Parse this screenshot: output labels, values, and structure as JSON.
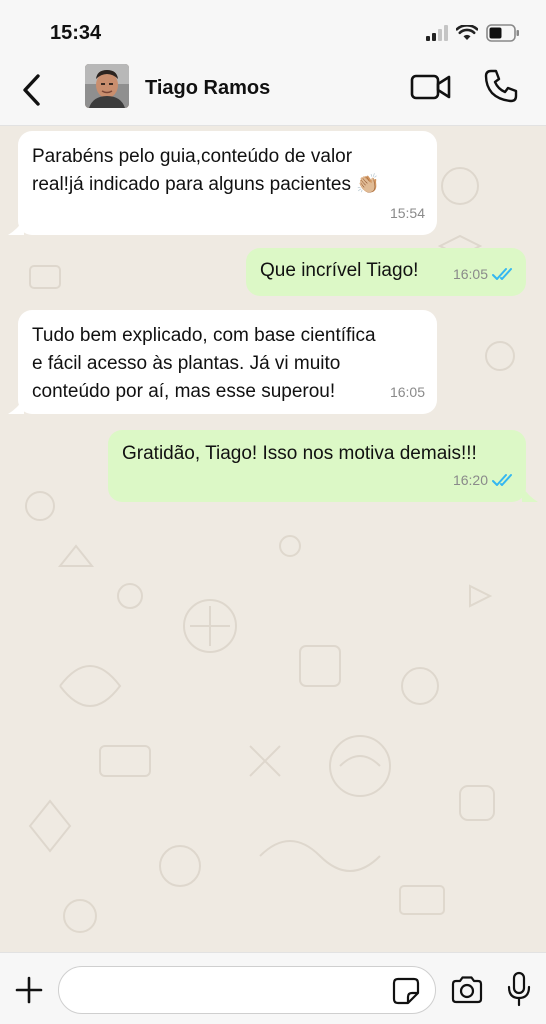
{
  "status": {
    "time": "15:34"
  },
  "contact": {
    "name": "Tiago Ramos"
  },
  "messages": [
    {
      "direction": "incoming",
      "lines": [
        "Parabéns pelo guia,conteúdo de valor",
        "real!já indicado para alguns pacientes 👏🏼"
      ],
      "time": "15:54"
    },
    {
      "direction": "outgoing",
      "text": "Que incrível Tiago!",
      "time": "16:05",
      "status": "read"
    },
    {
      "direction": "incoming",
      "lines": [
        "Tudo bem explicado, com base científica",
        "e fácil acesso às plantas. Já vi muito",
        "conteúdo por aí, mas esse superou!"
      ],
      "time": "16:05"
    },
    {
      "direction": "outgoing",
      "text": "Gratidão, Tiago! Isso nos motiva demais!!!",
      "time": "16:20",
      "status": "read"
    }
  ],
  "composer": {
    "value": "",
    "placeholder": ""
  },
  "colors": {
    "outgoing_bubble": "#dcf8c6",
    "incoming_bubble": "#ffffff",
    "read_ticks": "#34b7f1",
    "chat_bg": "#efeae2"
  },
  "icons": [
    "back-chevron-icon",
    "video-camera-icon",
    "phone-icon",
    "plus-icon",
    "sticker-icon",
    "camera-icon",
    "microphone-icon",
    "double-check-icon"
  ]
}
